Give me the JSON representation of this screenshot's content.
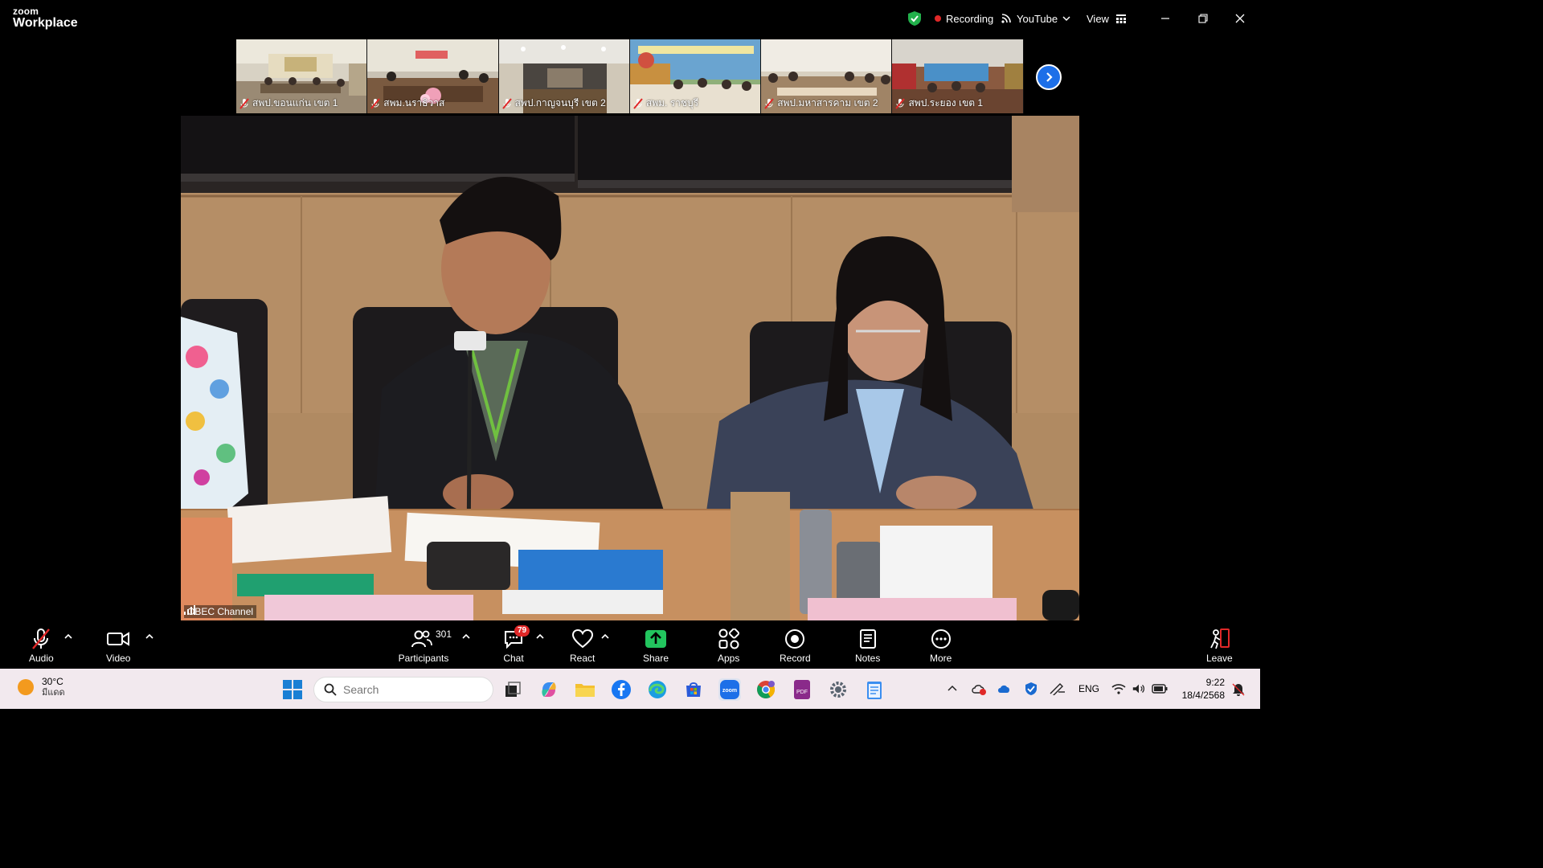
{
  "window": {
    "brand_small": "zoom",
    "brand_large": "Workplace",
    "recording_label": "Recording",
    "stream_label": "YouTube",
    "view_label": "View"
  },
  "thumbnails": [
    {
      "label": "สพป.ขอนแก่น เขต 1"
    },
    {
      "label": "สพม.นราธิวาส"
    },
    {
      "label": "สพป.กาญจนบุรี เขต 2"
    },
    {
      "label": "สพม. ราชบุรี"
    },
    {
      "label": "สพป.มหาสารคาม เขต 2"
    },
    {
      "label": "สพป.ระยอง เขต 1"
    }
  ],
  "main_video": {
    "participant_name": "OBEC Channel"
  },
  "toolbar": {
    "audio": "Audio",
    "video": "Video",
    "participants": "Participants",
    "participants_count": "301",
    "chat": "Chat",
    "chat_badge": "79",
    "react": "React",
    "share": "Share",
    "apps": "Apps",
    "record": "Record",
    "notes": "Notes",
    "more": "More",
    "leave": "Leave"
  },
  "taskbar": {
    "temperature": "30°C",
    "weather": "มีแดด",
    "search_placeholder": "Search",
    "language": "ENG",
    "time": "9:22",
    "date": "18/4/2568"
  },
  "colors": {
    "zoom_blue": "#1d6fe8",
    "record_red": "#e02828",
    "share_green": "#22c55e",
    "shield_green": "#22b04b"
  }
}
